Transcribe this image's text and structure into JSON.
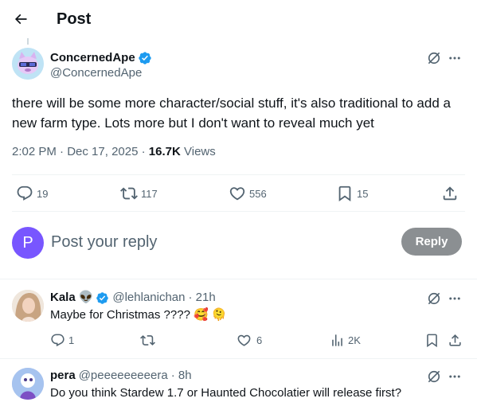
{
  "header": {
    "title": "Post"
  },
  "post": {
    "author_name": "ConcernedApe",
    "author_handle": "@ConcernedApe",
    "text": "there will be some more character/social stuff, it's also traditional to add a new farm type. Lots more but I don't want to reveal much yet",
    "time": "2:02 PM",
    "date": "Dec 17, 2025",
    "views_count": "16.7K",
    "views_label": "Views",
    "replies": "19",
    "reposts": "117",
    "likes": "556",
    "bookmarks": "15"
  },
  "reply_box": {
    "avatar_letter": "P",
    "placeholder": "Post your reply",
    "button_label": "Reply"
  },
  "comments": [
    {
      "name": "Kala",
      "name_emoji": "👽",
      "handle": "@lehlanichan",
      "time": "· 21h",
      "text": "Maybe for Christmas ????",
      "emojis": "🥰 🫠",
      "replies": "1",
      "reposts": "",
      "likes": "6",
      "views": "2K"
    },
    {
      "name": "pera",
      "handle": "@peeeeeeeeera",
      "time": "· 8h",
      "text": "Do you think Stardew 1.7 or Haunted Chocolatier will release first?"
    }
  ],
  "colors": {
    "text": "#0f1419",
    "secondary": "#536471",
    "verified": "#1d9bf0",
    "reply_avatar": "#7856ff",
    "reply_button": "#8b8f92",
    "divider": "#eff3f4"
  },
  "icons": [
    "back-arrow-icon",
    "verified-badge-icon",
    "grok-icon",
    "more-icon",
    "reply-icon",
    "repost-icon",
    "like-icon",
    "bookmark-icon",
    "share-icon",
    "views-icon"
  ]
}
